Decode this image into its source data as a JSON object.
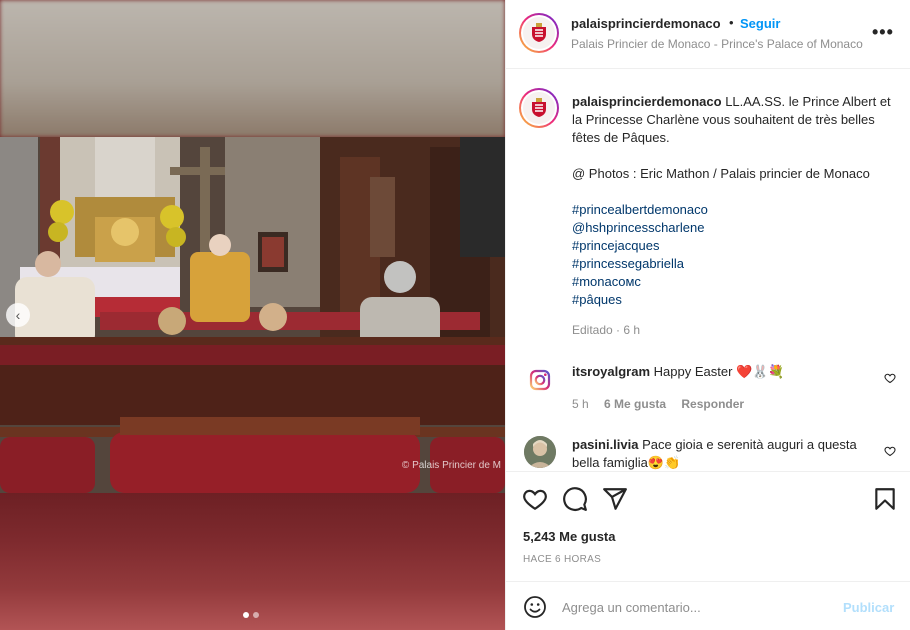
{
  "post": {
    "username": "palaisprincierdemonaco",
    "separator": "•",
    "follow_label": "Seguir",
    "location": "Palais Princier de Monaco - Prince's Palace of Monaco",
    "more_label": "•••"
  },
  "caption": {
    "username": "palaisprincierdemonaco",
    "text": "LL.AA.SS. le Prince Albert et la Princesse Charlène vous souhaitent de très belles fêtes de Pâques.",
    "credit": "@ Photos : Eric Mathon / Palais princier de Monaco",
    "hashtags": [
      "#princealbertdemonaco",
      "@hshprincesscharlene",
      "#princejacques",
      "#princessegabriella",
      "#monacoмс",
      "#pâques"
    ],
    "edited": "Editado · 6 h"
  },
  "comments": [
    {
      "username": "itsroyalgram",
      "text": "Happy Easter ❤️🐰💐",
      "time": "5 h",
      "likes": "6 Me gusta",
      "reply_label": "Responder"
    },
    {
      "username": "pasini.livia",
      "text": "Pace gioia e serenità auguri a questa bella famiglia😍👏"
    }
  ],
  "stats": {
    "likes": "5,243 Me gusta",
    "time": "HACE 6 HORAS"
  },
  "add_comment": {
    "placeholder": "Agrega un comentario...",
    "publish_label": "Publicar"
  },
  "media": {
    "watermark": "© Palais Princier de M",
    "slide_index": 1,
    "slide_count": 2
  },
  "colors": {
    "accent": "#0095f6",
    "publish_disabled": "#b2dffc",
    "secondary_text": "#8e8e8e",
    "hashtag": "#00376b"
  }
}
